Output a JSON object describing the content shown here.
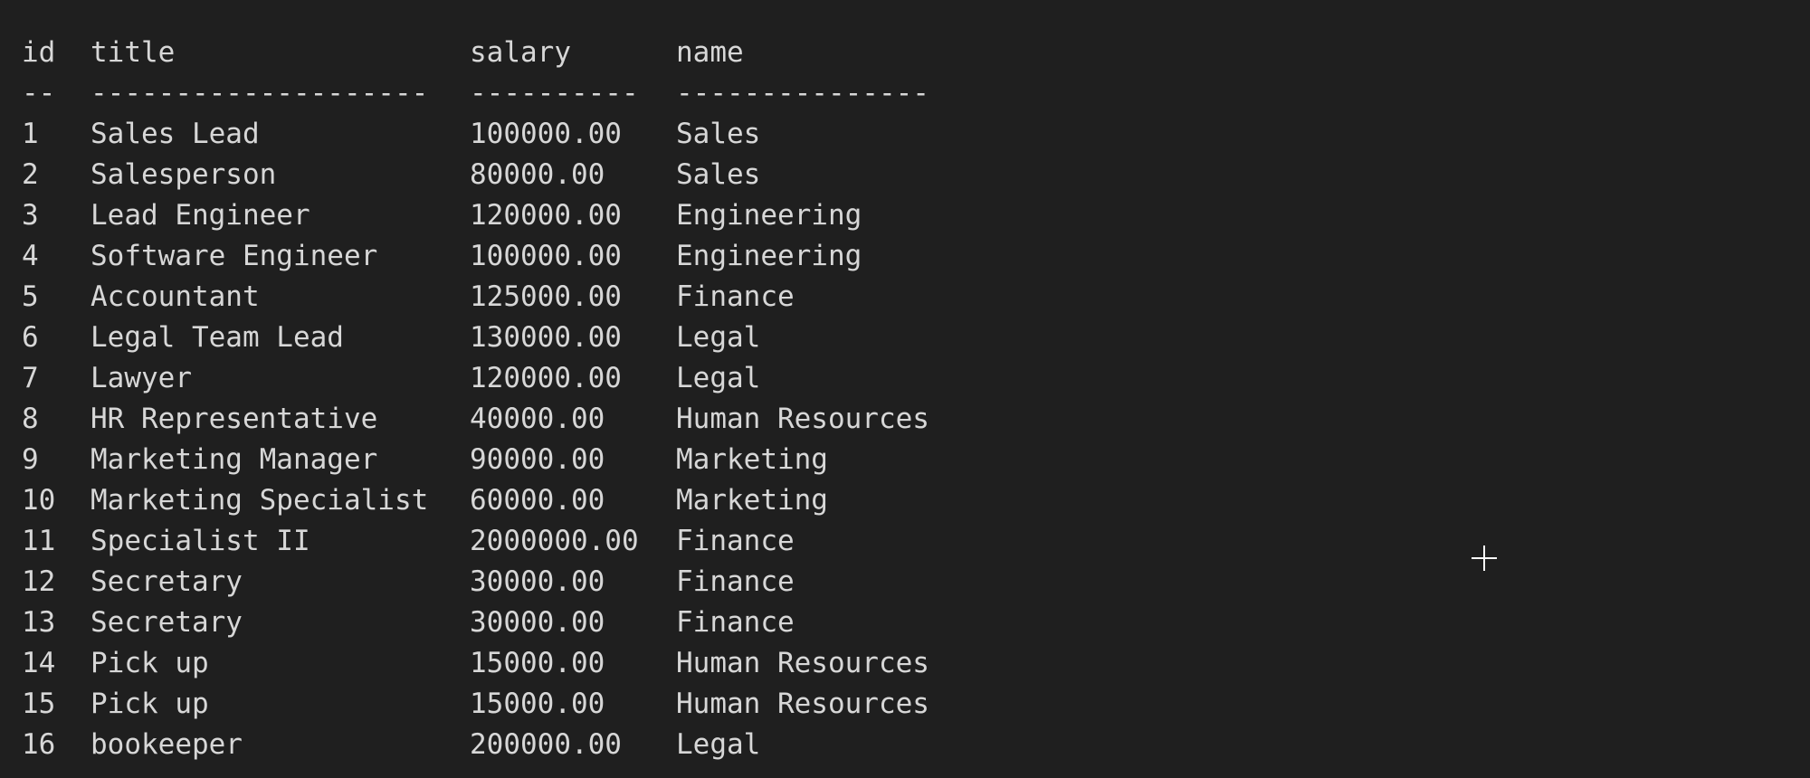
{
  "table": {
    "headers": {
      "id": "id",
      "title": "title",
      "salary": "salary",
      "name": "name"
    },
    "separators": {
      "id": "--",
      "title": "--------------------",
      "salary": "----------",
      "name": "---------------"
    },
    "rows": [
      {
        "id": "1",
        "title": "Sales Lead",
        "salary": "100000.00",
        "name": "Sales"
      },
      {
        "id": "2",
        "title": "Salesperson",
        "salary": "80000.00",
        "name": "Sales"
      },
      {
        "id": "3",
        "title": "Lead Engineer",
        "salary": "120000.00",
        "name": "Engineering"
      },
      {
        "id": "4",
        "title": "Software Engineer",
        "salary": "100000.00",
        "name": "Engineering"
      },
      {
        "id": "5",
        "title": "Accountant",
        "salary": "125000.00",
        "name": "Finance"
      },
      {
        "id": "6",
        "title": "Legal Team Lead",
        "salary": "130000.00",
        "name": "Legal"
      },
      {
        "id": "7",
        "title": "Lawyer",
        "salary": "120000.00",
        "name": "Legal"
      },
      {
        "id": "8",
        "title": "HR Representative",
        "salary": "40000.00",
        "name": "Human Resources"
      },
      {
        "id": "9",
        "title": "Marketing Manager",
        "salary": "90000.00",
        "name": "Marketing"
      },
      {
        "id": "10",
        "title": "Marketing Specialist",
        "salary": "60000.00",
        "name": "Marketing"
      },
      {
        "id": "11",
        "title": "Specialist II",
        "salary": "2000000.00",
        "name": "Finance"
      },
      {
        "id": "12",
        "title": "Secretary",
        "salary": "30000.00",
        "name": "Finance"
      },
      {
        "id": "13",
        "title": "Secretary",
        "salary": "30000.00",
        "name": "Finance"
      },
      {
        "id": "14",
        "title": "Pick up",
        "salary": "15000.00",
        "name": "Human Resources"
      },
      {
        "id": "15",
        "title": "Pick up",
        "salary": "15000.00",
        "name": "Human Resources"
      },
      {
        "id": "16",
        "title": "bookeeper",
        "salary": "200000.00",
        "name": "Legal"
      }
    ]
  },
  "colors": {
    "background": "#1f1f1f",
    "text": "#d7d7d7",
    "cursor": "#ffffff"
  },
  "cursor_icon": "crosshair-cursor-icon"
}
